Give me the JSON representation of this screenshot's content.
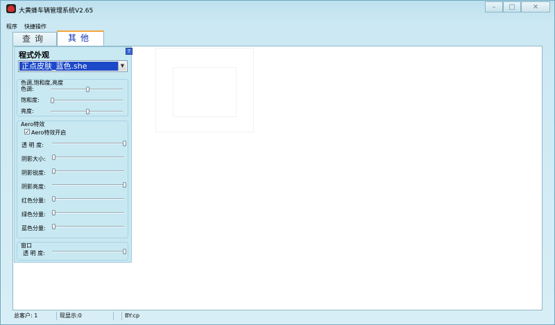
{
  "window": {
    "title": "大黄蜂车辆管理系统V2.65",
    "controls": [
      "minimize-icon",
      "maximize-icon",
      "close-icon"
    ]
  },
  "menu": {
    "items": [
      "程序",
      "快捷操作"
    ]
  },
  "tabs": [
    {
      "label": "查询",
      "active": false
    },
    {
      "label": "其他",
      "active": true
    }
  ],
  "appearance": {
    "title": "程式外观",
    "skin_select": {
      "value": "正点皮肤_蓝色.she"
    },
    "hsl_group": {
      "title": "色调,饱和度,亮度",
      "sliders": [
        {
          "label": "色调:",
          "value": 0.5
        },
        {
          "label": "饱和度:",
          "value": 0.0
        },
        {
          "label": "亮度:",
          "value": 0.5
        }
      ]
    },
    "aero_group": {
      "title": "Aero特效",
      "checkbox": {
        "label": "Aero特效开启",
        "checked": true
      },
      "sliders": [
        {
          "label": "透 明 度:",
          "value": 1.0
        },
        {
          "label": "阴影大小:",
          "value": 0.0
        },
        {
          "label": "阴影锐度:",
          "value": 0.0
        },
        {
          "label": "阴影亮度:",
          "value": 1.0
        },
        {
          "label": "红色分量:",
          "value": 0.0
        },
        {
          "label": "绿色分量:",
          "value": 0.0
        },
        {
          "label": "蓝色分量:",
          "value": 0.0
        }
      ]
    },
    "window_group": {
      "title": "窗口",
      "sliders": [
        {
          "label": "透 明 度:",
          "value": 1.0
        }
      ]
    }
  },
  "statusbar": {
    "customers": "总客户: 1",
    "showing": "现显示:0",
    "author": "BY:cp"
  }
}
